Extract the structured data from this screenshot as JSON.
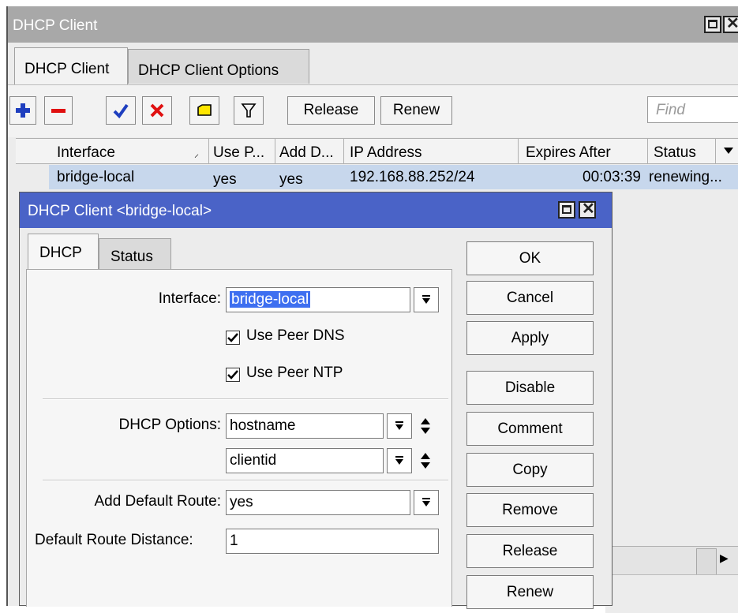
{
  "main_window": {
    "title": "DHCP Client",
    "tabs": [
      "DHCP Client",
      "DHCP Client Options"
    ],
    "toolbar": {
      "add_icon": "plus-icon",
      "remove_icon": "minus-icon",
      "enable_icon": "check-icon",
      "disable_icon": "x-icon",
      "comment_icon": "note-icon",
      "filter_icon": "filter-icon",
      "release_label": "Release",
      "renew_label": "Renew",
      "find_placeholder": "Find"
    },
    "columns": [
      "Interface",
      "Use P...",
      "Add D...",
      "IP Address",
      "Expires After",
      "Status"
    ],
    "rows": [
      {
        "interface": "bridge-local",
        "use_peer": "yes",
        "add_default": "yes",
        "ip_address": "192.168.88.252/24",
        "expires_after": "00:03:39",
        "status": "renewing..."
      }
    ]
  },
  "dialog": {
    "title": "DHCP Client <bridge-local>",
    "tabs": [
      "DHCP",
      "Status"
    ],
    "interface_label": "Interface:",
    "interface_value": "bridge-local",
    "use_peer_dns_label": "Use Peer DNS",
    "use_peer_dns_checked": true,
    "use_peer_ntp_label": "Use Peer NTP",
    "use_peer_ntp_checked": true,
    "dhcp_options_label": "DHCP Options:",
    "dhcp_options": [
      "hostname",
      "clientid"
    ],
    "add_default_route_label": "Add Default Route:",
    "add_default_route_value": "yes",
    "default_route_distance_label": "Default Route Distance:",
    "default_route_distance_value": "1",
    "buttons": [
      "OK",
      "Cancel",
      "Apply",
      "Disable",
      "Comment",
      "Copy",
      "Remove",
      "Release",
      "Renew"
    ]
  },
  "colors": {
    "dialog_titlebar": "#4a63c7",
    "main_titlebar": "#a8a8a8",
    "selected_row": "#c7d7ec",
    "add_icon": "#1f3fbf",
    "remove_icon": "#e01010",
    "text_selection": "#3e6ff0"
  }
}
